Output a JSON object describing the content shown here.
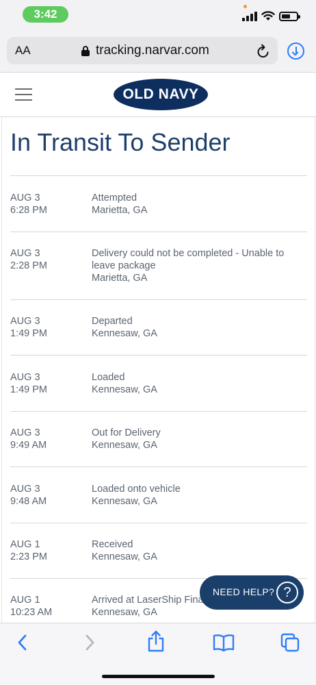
{
  "status_bar": {
    "time": "3:42",
    "signal_icon": "cellular-signal-icon",
    "wifi_icon": "wifi-icon",
    "battery_icon": "battery-icon",
    "battery_level": 0.45
  },
  "browser": {
    "text_size_label": "AA",
    "url": "tracking.narvar.com",
    "lock_icon": "lock-icon",
    "reload_icon": "reload-icon",
    "download_icon": "download-icon"
  },
  "site_header": {
    "menu_icon": "hamburger-menu-icon",
    "logo_text": "OLD NAVY",
    "brand_color": "#0d2e5f"
  },
  "tracking": {
    "title": "In Transit To Sender",
    "events": [
      {
        "date": "AUG 3",
        "time": "6:28 PM",
        "status": "Attempted",
        "location": "Marietta, GA"
      },
      {
        "date": "AUG 3",
        "time": "2:28 PM",
        "status": "Delivery could not be completed - Unable to leave package",
        "location": "Marietta, GA"
      },
      {
        "date": "AUG 3",
        "time": "1:49 PM",
        "status": "Departed",
        "location": "Kennesaw, GA"
      },
      {
        "date": "AUG 3",
        "time": "1:49 PM",
        "status": "Loaded",
        "location": "Kennesaw, GA"
      },
      {
        "date": "AUG 3",
        "time": "9:49 AM",
        "status": "Out for Delivery",
        "location": "Kennesaw, GA"
      },
      {
        "date": "AUG 3",
        "time": "9:48 AM",
        "status": "Loaded onto vehicle",
        "location": "Kennesaw, GA"
      },
      {
        "date": "AUG 1",
        "time": "2:23 PM",
        "status": "Received",
        "location": "Kennesaw, GA"
      },
      {
        "date": "AUG 1",
        "time": "10:23 AM",
        "status": "Arrived at LaserShip Fina",
        "location": "Kennesaw, GA"
      }
    ]
  },
  "help": {
    "label": "NEED HELP?",
    "icon_text": "?",
    "color": "#1b3f6b"
  },
  "toolbar": {
    "back_icon": "back-chevron-icon",
    "forward_icon": "forward-chevron-icon",
    "share_icon": "share-icon",
    "bookmarks_icon": "bookmarks-icon",
    "tabs_icon": "tabs-icon",
    "accent": "#2f7cf6"
  }
}
